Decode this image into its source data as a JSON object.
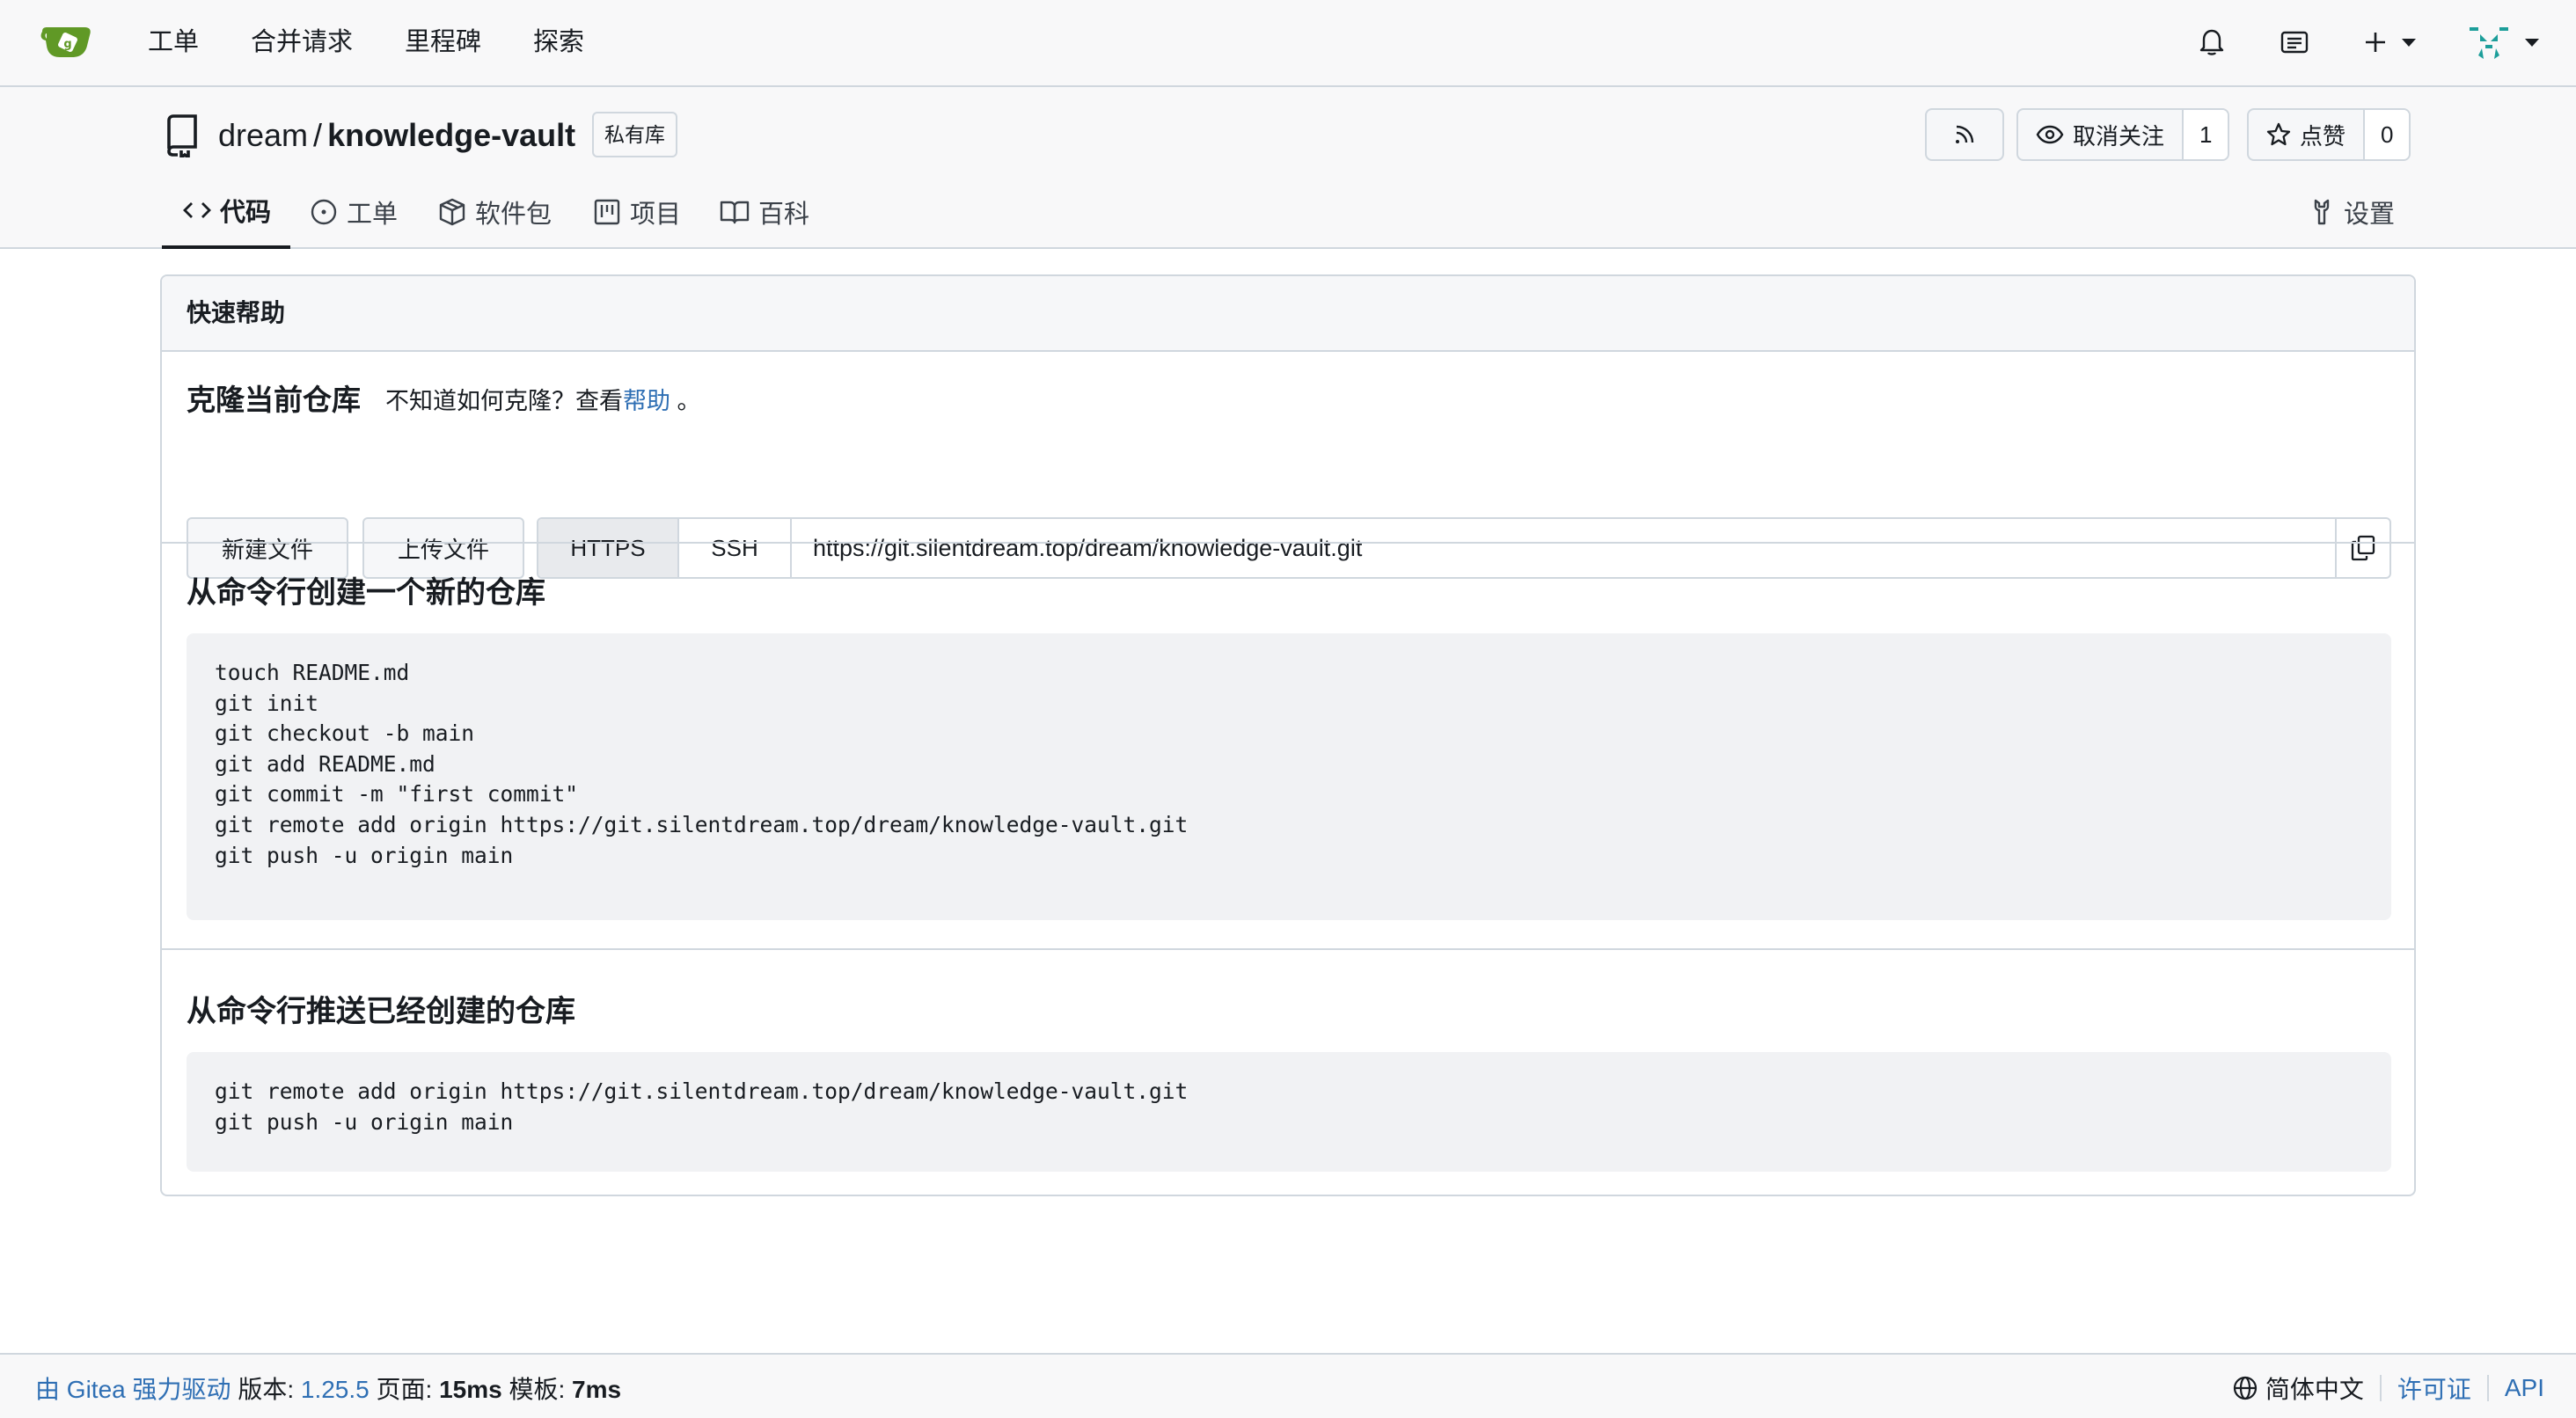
{
  "topnav": {
    "items": [
      "工单",
      "合并请求",
      "里程碑",
      "探索"
    ]
  },
  "repo": {
    "owner": "dream",
    "separator": "/",
    "name": "knowledge-vault",
    "private_badge": "私有库",
    "watch_label": "取消关注",
    "watch_count": "1",
    "star_label": "点赞",
    "star_count": "0"
  },
  "tabs": [
    {
      "label": "代码",
      "icon": "code-icon"
    },
    {
      "label": "工单",
      "icon": "issue-opened-icon"
    },
    {
      "label": "软件包",
      "icon": "package-icon"
    },
    {
      "label": "项目",
      "icon": "project-icon"
    },
    {
      "label": "百科",
      "icon": "book-icon"
    },
    {
      "label": "设置",
      "icon": "tools-icon"
    }
  ],
  "quick_help": {
    "header": "快速帮助",
    "clone_title": "克隆当前仓库",
    "clone_hint_prefix": "不知道如何克隆？查看",
    "clone_hint_link": "帮助",
    "clone_hint_suffix": " 。",
    "new_file": "新建文件",
    "upload_file": "上传文件",
    "https": "HTTPS",
    "ssh": "SSH",
    "url": "https://git.silentdream.top/dream/knowledge-vault.git"
  },
  "new_repo": {
    "title": "从命令行创建一个新的仓库",
    "code": "touch README.md\ngit init\ngit checkout -b main\ngit add README.md\ngit commit -m \"first commit\"\ngit remote add origin https://git.silentdream.top/dream/knowledge-vault.git\ngit push -u origin main"
  },
  "push_existing": {
    "title": "从命令行推送已经创建的仓库",
    "code": "git remote add origin https://git.silentdream.top/dream/knowledge-vault.git\ngit push -u origin main"
  },
  "footer": {
    "powered_prefix": "由",
    "powered_gitea": "Gitea",
    "powered_suffix": "强力驱动",
    "version_label": "版本:",
    "version": "1.25.5",
    "page_label": "页面:",
    "page_time": "15ms",
    "template_label": "模板:",
    "template_time": "7ms",
    "language": "简体中文",
    "license": "许可证",
    "api": "API"
  },
  "colors": {
    "link": "#2f6fb4",
    "gitea_green": "#609926",
    "avatar_teal": "#1c9e9a"
  }
}
